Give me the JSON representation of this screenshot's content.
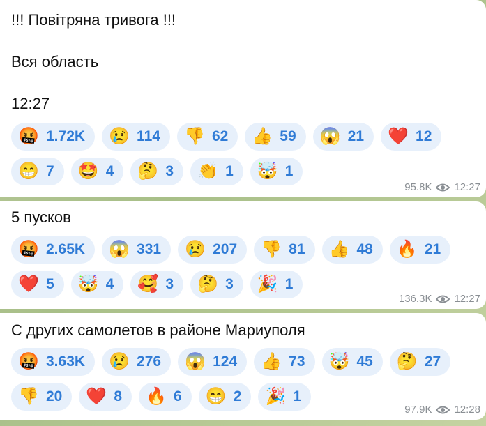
{
  "messages": [
    {
      "text": "!!! Повітряна тривога !!!\n\nВся область\n\n12:27",
      "rows": [
        [
          {
            "icon": "swearing-face-icon",
            "glyph": "🤬",
            "count": "1.72K"
          },
          {
            "icon": "crying-face-icon",
            "glyph": "😢",
            "count": "114"
          },
          {
            "icon": "thumbs-down-icon",
            "glyph": "👎",
            "count": "62"
          },
          {
            "icon": "thumbs-up-icon",
            "glyph": "👍",
            "count": "59"
          },
          {
            "icon": "screaming-face-icon",
            "glyph": "😱",
            "count": "21"
          },
          {
            "icon": "red-heart-icon",
            "glyph": "❤️",
            "count": "12"
          }
        ],
        [
          {
            "icon": "grinning-face-icon",
            "glyph": "😁",
            "count": "7"
          },
          {
            "icon": "star-struck-icon",
            "glyph": "🤩",
            "count": "4"
          },
          {
            "icon": "thinking-face-icon",
            "glyph": "🤔",
            "count": "3"
          },
          {
            "icon": "clapping-hands-icon",
            "glyph": "👏",
            "count": "1"
          },
          {
            "icon": "exploding-head-icon",
            "glyph": "🤯",
            "count": "1"
          }
        ]
      ],
      "views": "95.8K",
      "time": "12:27"
    },
    {
      "text": "5 пусков",
      "rows": [
        [
          {
            "icon": "swearing-face-icon",
            "glyph": "🤬",
            "count": "2.65K"
          },
          {
            "icon": "screaming-face-icon",
            "glyph": "😱",
            "count": "331"
          },
          {
            "icon": "crying-face-icon",
            "glyph": "😢",
            "count": "207"
          },
          {
            "icon": "thumbs-down-icon",
            "glyph": "👎",
            "count": "81"
          },
          {
            "icon": "thumbs-up-icon",
            "glyph": "👍",
            "count": "48"
          },
          {
            "icon": "fire-icon",
            "glyph": "🔥",
            "count": "21"
          }
        ],
        [
          {
            "icon": "red-heart-icon",
            "glyph": "❤️",
            "count": "5"
          },
          {
            "icon": "exploding-head-icon",
            "glyph": "🤯",
            "count": "4"
          },
          {
            "icon": "smiling-face-hearts-icon",
            "glyph": "🥰",
            "count": "3"
          },
          {
            "icon": "thinking-face-icon",
            "glyph": "🤔",
            "count": "3"
          },
          {
            "icon": "party-popper-icon",
            "glyph": "🎉",
            "count": "1"
          }
        ]
      ],
      "views": "136.3K",
      "time": "12:27"
    },
    {
      "text": "С других самолетов в районе Мариуполя",
      "rows": [
        [
          {
            "icon": "swearing-face-icon",
            "glyph": "🤬",
            "count": "3.63K"
          },
          {
            "icon": "crying-face-icon",
            "glyph": "😢",
            "count": "276"
          },
          {
            "icon": "screaming-face-icon",
            "glyph": "😱",
            "count": "124"
          },
          {
            "icon": "thumbs-up-icon",
            "glyph": "👍",
            "count": "73"
          },
          {
            "icon": "exploding-head-icon",
            "glyph": "🤯",
            "count": "45"
          },
          {
            "icon": "thinking-face-icon",
            "glyph": "🤔",
            "count": "27"
          }
        ],
        [
          {
            "icon": "thumbs-down-icon",
            "glyph": "👎",
            "count": "20"
          },
          {
            "icon": "red-heart-icon",
            "glyph": "❤️",
            "count": "8"
          },
          {
            "icon": "fire-icon",
            "glyph": "🔥",
            "count": "6"
          },
          {
            "icon": "grinning-face-icon",
            "glyph": "😁",
            "count": "2"
          },
          {
            "icon": "party-popper-icon",
            "glyph": "🎉",
            "count": "1"
          }
        ]
      ],
      "views": "97.9K",
      "time": "12:28"
    }
  ]
}
